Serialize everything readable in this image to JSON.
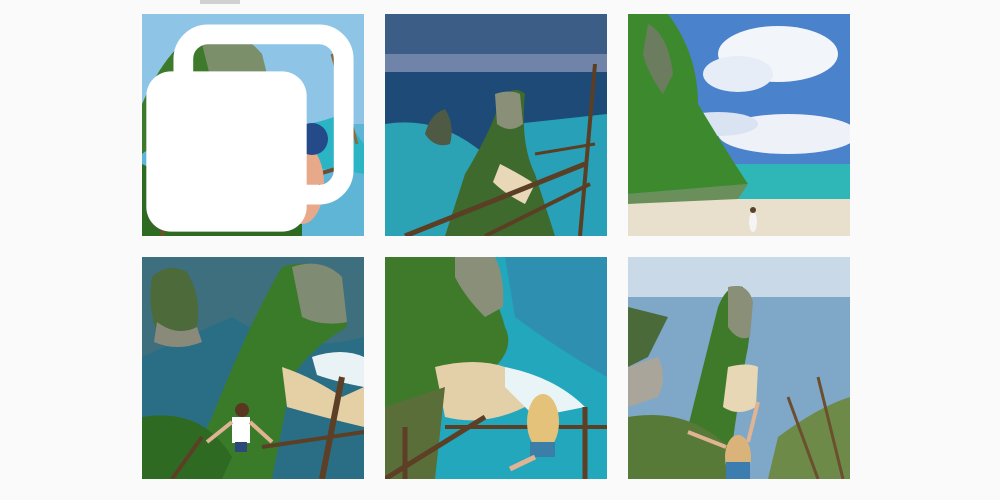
{
  "grid": {
    "posts": [
      {
        "alt": "photo",
        "scene": "woman-headscarf-cliff-stairs",
        "multi": true
      },
      {
        "alt": "photo",
        "scene": "aerial-sunset-trex-cliff",
        "multi": false
      },
      {
        "alt": "photo",
        "scene": "green-cliff-beach-sky",
        "multi": false
      },
      {
        "alt": "photo",
        "scene": "woman-arms-up-cliff",
        "multi": false
      },
      {
        "alt": "photo",
        "scene": "woman-sitting-railing",
        "multi": false
      },
      {
        "alt": "photo",
        "scene": "woman-back-view-cliff",
        "multi": false
      }
    ]
  },
  "colors": {
    "background": "#fafafa",
    "sea": "#1fa6b8",
    "deep_sea": "#1c4f7a",
    "cliff": "#3f7d2a",
    "sand": "#e8d6b0",
    "sky": "#7fb6e6"
  },
  "icons": {
    "multi_post": "carousel-icon"
  }
}
